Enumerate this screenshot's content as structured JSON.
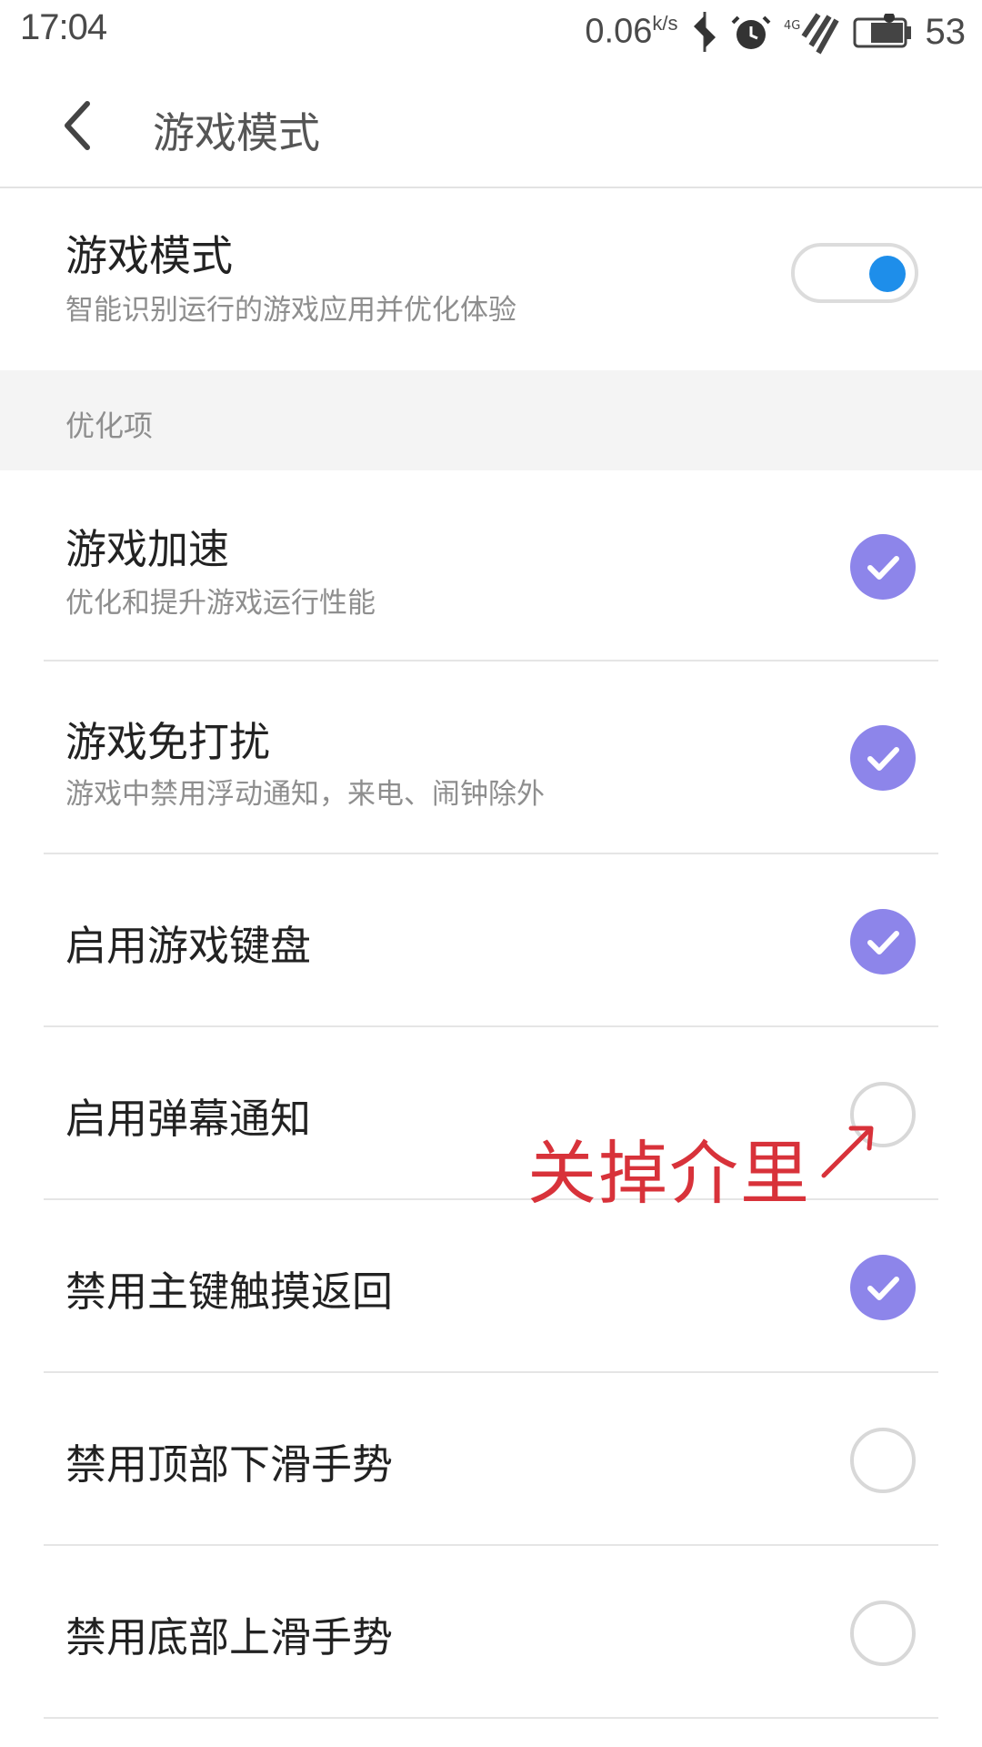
{
  "status_bar": {
    "time": "17:04",
    "speed": "0.06",
    "speed_unit": "k/s",
    "network": "4G",
    "battery_level": "53"
  },
  "app_bar": {
    "back_icon": "chevron-left-icon",
    "title": "游戏模式"
  },
  "master": {
    "title": "游戏模式",
    "subtitle": "智能识别运行的游戏应用并优化体验",
    "enabled": true,
    "accent": "#1e8eea"
  },
  "section": {
    "label": "优化项"
  },
  "options": [
    {
      "title": "游戏加速",
      "subtitle": "优化和提升游戏运行性能",
      "checked": true
    },
    {
      "title": "游戏免打扰",
      "subtitle": "游戏中禁用浮动通知，来电、闹钟除外",
      "checked": true
    },
    {
      "title": "启用游戏键盘",
      "subtitle": "",
      "checked": true
    },
    {
      "title": "启用弹幕通知",
      "subtitle": "",
      "checked": false
    },
    {
      "title": "禁用主键触摸返回",
      "subtitle": "",
      "checked": true
    },
    {
      "title": "禁用顶部下滑手势",
      "subtitle": "",
      "checked": false
    },
    {
      "title": "禁用底部上滑手势",
      "subtitle": "",
      "checked": false
    }
  ],
  "annotation": {
    "text": "关掉介里",
    "color": "#d8323a"
  },
  "colors": {
    "check_on": "#8d85ea",
    "check_off_border": "#d8d8d8"
  }
}
